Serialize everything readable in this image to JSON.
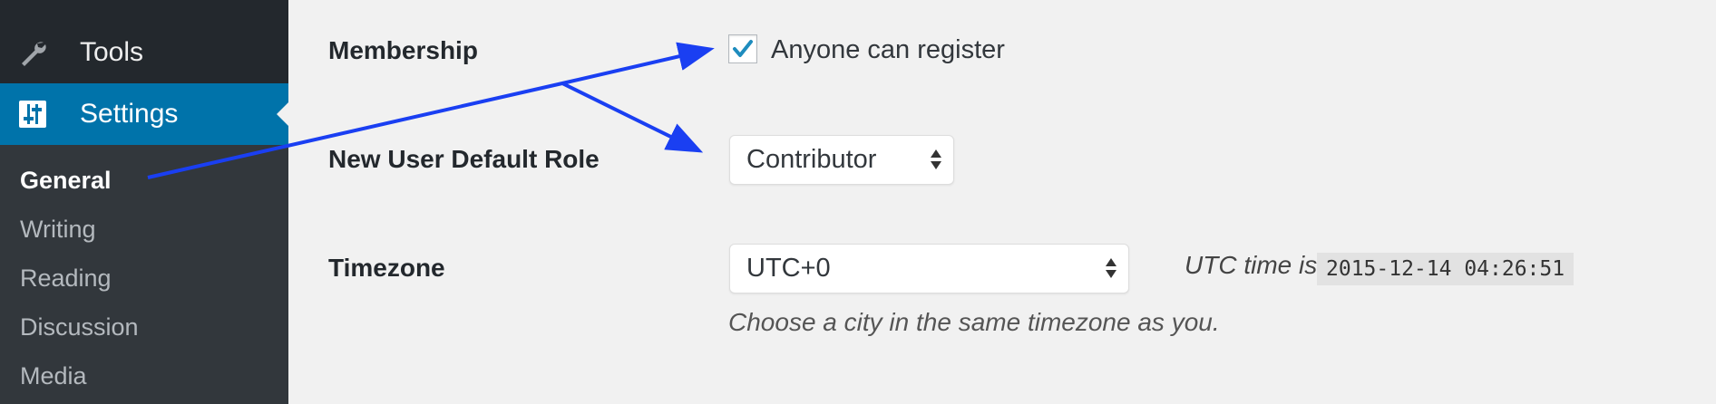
{
  "sidebar": {
    "items": [
      {
        "label": "Tools",
        "icon": "wrench-icon"
      },
      {
        "label": "Settings",
        "icon": "settings-sliders-icon",
        "active": true
      }
    ],
    "submenu": [
      {
        "label": "General",
        "current": true
      },
      {
        "label": "Writing"
      },
      {
        "label": "Reading"
      },
      {
        "label": "Discussion"
      },
      {
        "label": "Media"
      }
    ]
  },
  "settings": {
    "membership": {
      "label": "Membership",
      "checkbox_label": "Anyone can register",
      "checked": true
    },
    "default_role": {
      "label": "New User Default Role",
      "value": "Contributor"
    },
    "timezone": {
      "label": "Timezone",
      "value": "UTC+0",
      "utc_label": "UTC time is",
      "utc_time": "2015-12-14 04:26:51",
      "description": "Choose a city in the same timezone as you."
    }
  },
  "colors": {
    "sidebar_bg": "#23282d",
    "submenu_bg": "#32373c",
    "active_bg": "#0073aa",
    "checkmark": "#1e8cbe",
    "annotation_arrow": "#1a3ff2"
  }
}
